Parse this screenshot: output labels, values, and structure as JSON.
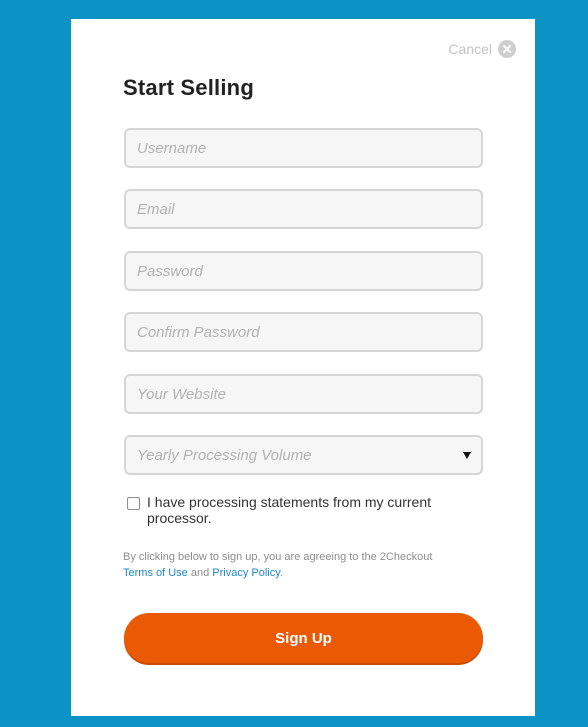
{
  "form": {
    "title": "Start Selling",
    "cancel_label": "Cancel",
    "cancel_icon": "close-circle-icon",
    "fields": {
      "username": {
        "placeholder": "Username",
        "value": ""
      },
      "email": {
        "placeholder": "Email",
        "value": ""
      },
      "password": {
        "placeholder": "Password",
        "value": ""
      },
      "confirm_password": {
        "placeholder": "Confirm Password",
        "value": ""
      },
      "website": {
        "placeholder": "Your Website",
        "value": ""
      }
    },
    "volume_select": {
      "selected": "Yearly Processing Volume",
      "icon": "dropdown-arrow-icon"
    },
    "statements_checkbox": {
      "label": "I have processing statements from my current processor.",
      "checked": false
    },
    "legal": {
      "prefix": "By clicking below to sign up, you are agreeing to the 2Checkout",
      "terms_link": "Terms of Use",
      "connector": "and",
      "privacy_link": "Privacy Policy",
      "suffix": "."
    },
    "signup_label": "Sign Up"
  },
  "colors": {
    "background": "#0a93c4",
    "card": "#ffffff",
    "primary_button": "#ea5a04",
    "link": "#1e88c8",
    "input_border": "#d6d6d6",
    "input_fill": "#f6f6f6"
  }
}
